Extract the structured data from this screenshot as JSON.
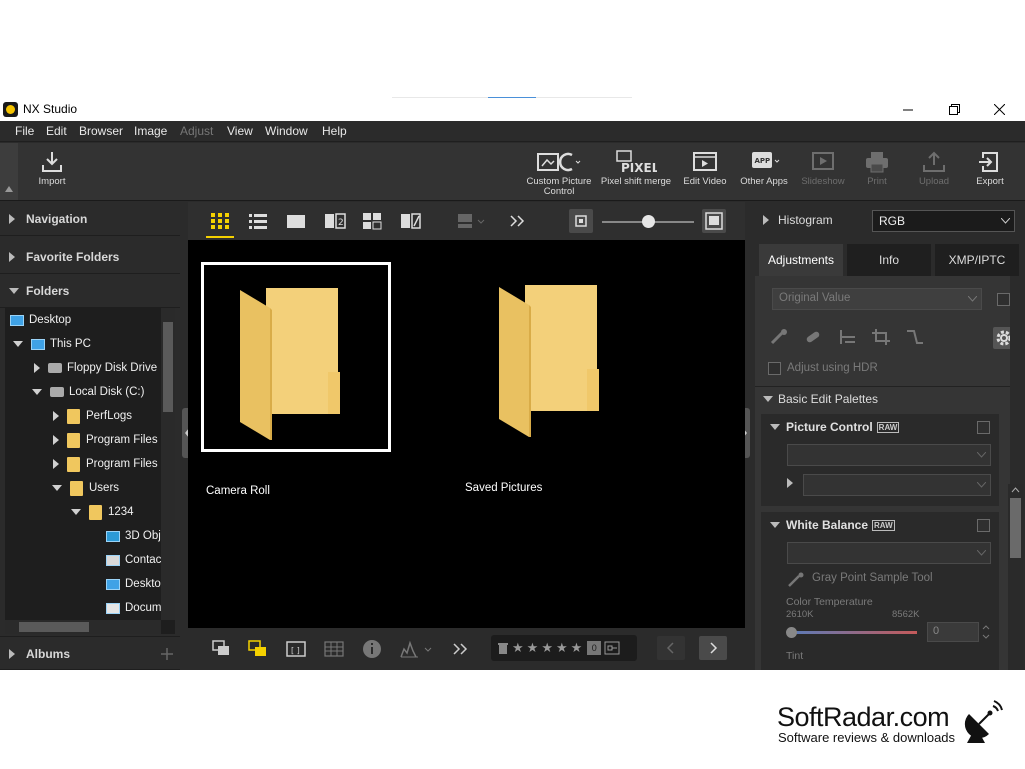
{
  "window": {
    "title": "NX Studio"
  },
  "menu": [
    "File",
    "Edit",
    "Browser",
    "Image",
    "Adjust",
    "View",
    "Window",
    "Help"
  ],
  "menu_disabled": [
    "Adjust"
  ],
  "toolbar": {
    "import": "Import",
    "custom_picture_control": "Custom Picture Control",
    "pixel_shift_merge": "Pixel shift merge",
    "edit_video": "Edit Video",
    "other_apps": "Other Apps",
    "slideshow": "Slideshow",
    "print": "Print",
    "upload": "Upload",
    "export": "Export",
    "pixel_icon_text": "PIXEL",
    "app_icon_text": "APP"
  },
  "left": {
    "navigation": "Navigation",
    "favorite_folders": "Favorite Folders",
    "folders": "Folders",
    "albums": "Albums",
    "tree": [
      "Desktop",
      "This PC",
      "Floppy Disk Drive",
      "Local Disk (C:)",
      "PerfLogs",
      "Program Files",
      "Program Files",
      "Users",
      "1234",
      "3D Obj",
      "Contac",
      "Deskto",
      "Docum"
    ]
  },
  "grid": {
    "items": [
      "Camera Roll",
      "Saved Pictures"
    ]
  },
  "bottom": {
    "rating_count": "0"
  },
  "right": {
    "histogram": "Histogram",
    "channel": "RGB",
    "tabs": [
      "Adjustments",
      "Info",
      "XMP/IPTC"
    ],
    "original_value": "Original Value",
    "adjust_hdr": "Adjust using HDR",
    "basic_edit": "Basic Edit Palettes",
    "picture_control": "Picture Control",
    "white_balance": "White Balance",
    "raw_badge": "RAW",
    "gray_point": "Gray Point Sample Tool",
    "color_temp": "Color Temperature",
    "temp_min": "2610K",
    "temp_max": "8562K",
    "temp_value": "0",
    "tint": "Tint"
  },
  "footer": {
    "brand": "SoftRadar.com",
    "tagline": "Software reviews & downloads"
  }
}
